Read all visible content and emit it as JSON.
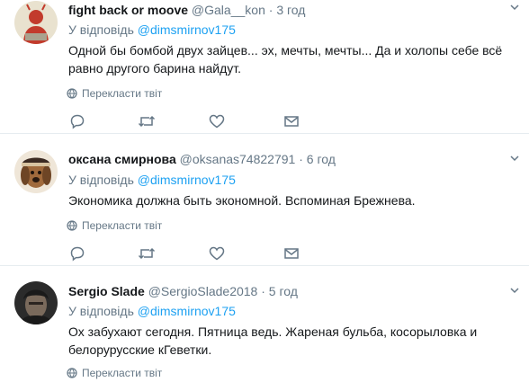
{
  "tweets": [
    {
      "name": "fight back or moove",
      "handle": "@Gala__kon",
      "dot": "·",
      "time": "3 год",
      "reply_prefix": "У відповідь",
      "reply_mention": "@dimsmirnov175",
      "text": "Одной бы бомбой двух зайцев... эх, мечты, мечты... Да и холопы себе всё равно другого барина найдут.",
      "translate": "Перекласти твіт"
    },
    {
      "name": "оксана смирнова",
      "handle": "@oksanas74822791",
      "dot": "·",
      "time": "6 год",
      "reply_prefix": "У відповідь",
      "reply_mention": "@dimsmirnov175",
      "text": "Экономика должна быть экономной. Вспоминая Брежнева.",
      "translate": "Перекласти твіт"
    },
    {
      "name": "Sergio Slade",
      "handle": "@SergioSlade2018",
      "dot": "·",
      "time": "5 год",
      "reply_prefix": "У відповідь",
      "reply_mention": "@dimsmirnov175",
      "text": "Ох забухают сегодня. Пятница ведь. Жареная бульба, косорыловка и белорурусские кГеветки.",
      "translate": "Перекласти твіт"
    }
  ],
  "icons": {
    "reply": "reply-icon",
    "retweet": "retweet-icon",
    "like": "heart-icon",
    "dm": "envelope-icon",
    "translate": "globe-icon",
    "more": "chevron-down-icon"
  },
  "colors": {
    "link": "#1da1f2",
    "secondary": "#657786",
    "text": "#14171a",
    "divider": "#e6ecf0"
  }
}
